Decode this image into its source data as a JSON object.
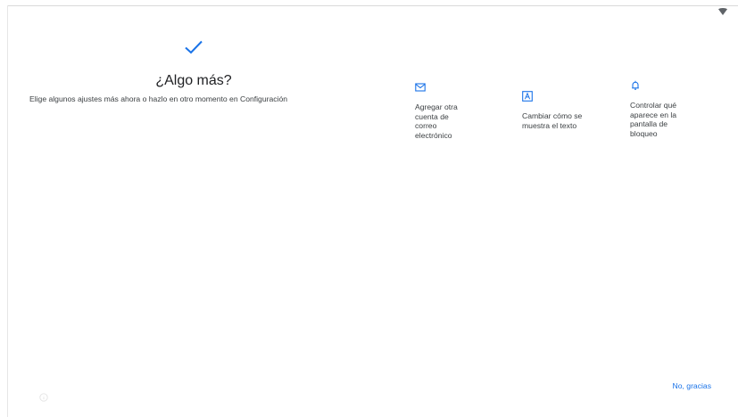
{
  "header": {
    "title": "¿Algo más?",
    "subtitle": "Elige algunos ajustes más ahora o hazlo en otro momento en Configuración"
  },
  "options": [
    {
      "icon": "email-icon",
      "label": "Agregar otra cuenta de correo electrónico"
    },
    {
      "icon": "text-size-icon",
      "label": "Cambiar cómo se muestra el texto"
    },
    {
      "icon": "bell-icon",
      "label": "Controlar qué aparece en la pantalla de bloqueo"
    }
  ],
  "footer": {
    "skip_label": "No, gracias"
  },
  "colors": {
    "accent": "#1a73e8",
    "text": "#202124",
    "secondary_text": "#3c4043"
  }
}
